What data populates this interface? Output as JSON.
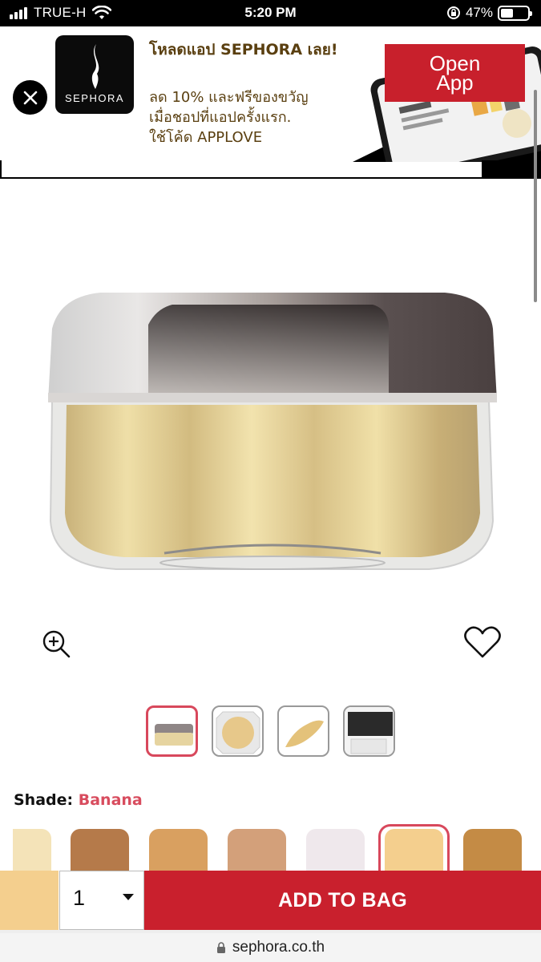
{
  "status_bar": {
    "carrier": "TRUE-H",
    "time": "5:20 PM",
    "battery": "47%",
    "battery_level": 0.47
  },
  "app_banner": {
    "logo_text": "SEPHORA",
    "title": "โหลดแอป SEPHORA เลย!",
    "description": "ลด 10% และฟรีของขวัญ\nเมื่อชอปที่แอปครั้งแรก.\nใช้โค้ด APPLOVE",
    "open_button": "Open\nApp",
    "colors": {
      "button": "#c8202c",
      "text": "#5a3f10"
    }
  },
  "product": {
    "image_icon": "powder-jar-image",
    "zoom_icon": "zoom-in-icon",
    "wishlist_icon": "heart-icon"
  },
  "thumbnails": [
    {
      "name": "jar-front",
      "active": true
    },
    {
      "name": "powder-top",
      "active": false
    },
    {
      "name": "swatch-smear",
      "active": false
    },
    {
      "name": "packaging-box",
      "active": false
    }
  ],
  "shade": {
    "label": "Shade:",
    "selected": "Banana",
    "swatches": [
      "#f4e3b8",
      "#b57a4a",
      "#d9a060",
      "#d3a07a",
      "#efe8ec",
      "#f4cf8e",
      "#c48b45"
    ],
    "selected_index": 5
  },
  "purchase": {
    "quantity": "1",
    "add_to_bag": "ADD TO BAG",
    "bar_swatch_color": "#f4cf8e"
  },
  "browser": {
    "url": "sephora.co.th"
  }
}
